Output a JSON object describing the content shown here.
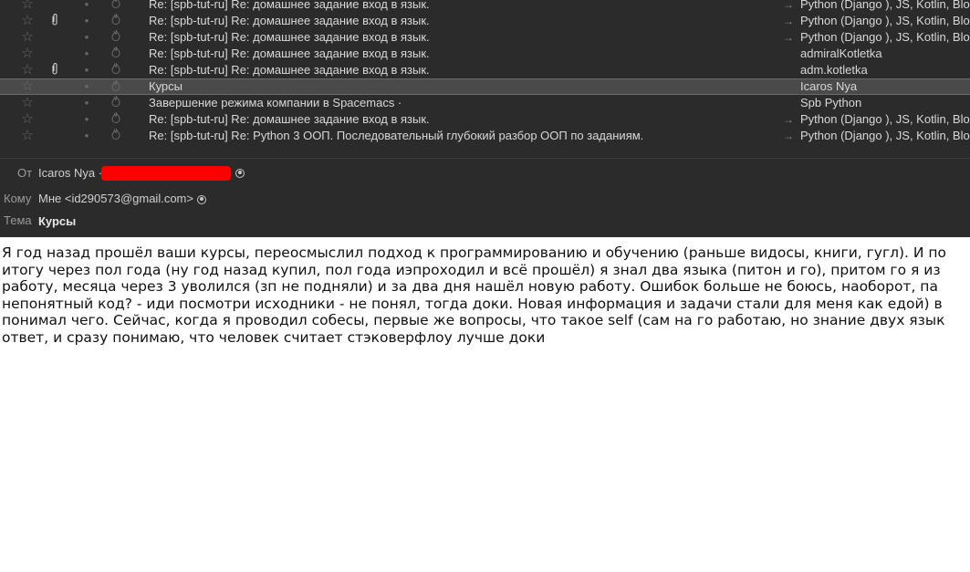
{
  "message_list": [
    {
      "subject": "Re: [spb-tut-ru] Re: домашнее задание вход в язык.",
      "sender": "Python (Django ), JS, Kotlin, Blo",
      "attachment": false,
      "arrow": true
    },
    {
      "subject": "Re: [spb-tut-ru] Re: домашнее задание вход в язык.",
      "sender": "Python (Django ), JS, Kotlin, Blo",
      "attachment": true,
      "arrow": true
    },
    {
      "subject": "Re: [spb-tut-ru] Re: домашнее задание вход в язык.",
      "sender": "Python (Django ), JS, Kotlin, Blo",
      "attachment": false,
      "arrow": true
    },
    {
      "subject": "Re: [spb-tut-ru] Re: домашнее задание вход в язык.",
      "sender": "admiralKotletka",
      "attachment": false,
      "arrow": false
    },
    {
      "subject": "Re: [spb-tut-ru] Re: домашнее задание вход в язык.",
      "sender": "adm.kotletka",
      "attachment": true,
      "arrow": false
    },
    {
      "subject": "Курсы",
      "sender": "Icaros Nya",
      "attachment": false,
      "arrow": false,
      "selected": true
    },
    {
      "subject": "Завершение режима компании в Spacemacs ·",
      "sender": "Spb Python",
      "attachment": false,
      "arrow": false
    },
    {
      "subject": "Re: [spb-tut-ru] Re: домашнее задание вход в язык.",
      "sender": "Python (Django ), JS, Kotlin, Blo",
      "attachment": false,
      "arrow": true
    },
    {
      "subject": "Re: [spb-tut-ru] Re: Python 3 ООП. Последовательный глубокий разбор ООП по заданиям.",
      "sender": "Python (Django ), JS, Kotlin, Blo",
      "attachment": false,
      "arrow": true
    }
  ],
  "icons": {
    "star": "star-icon",
    "attachment": "paperclip-icon",
    "read_status": "dot-icon",
    "junk": "flame-icon",
    "thread": "reply-arrow-icon",
    "contact": "person-icon"
  },
  "header": {
    "from_label": "От",
    "from_value": "Icaros Nya ·",
    "to_label": "Кому",
    "to_value": "Мне <id290573@gmail.com>",
    "subject_label": "Тема",
    "subject_value": "Курсы"
  },
  "body_lines": [
    "Я год назад прошёл ваши курсы, переосмыслил подход к программированию и обучению (раньше видосы, книги, гугл). И по",
    "итогу через пол года (ну год назад купил, пол года иэпроходил и всё прошёл) я знал два языка (питон и го), притом го я из",
    "работу, месяца через 3 уволился (зп не подняли) и за два дня нашёл новую работу. Ошибок больше не боюсь, наоборот, па",
    "непонятный код? - иди посмотри исходники - не понял, тогда доки. Новая информация и задачи стали для меня как едой) в",
    "понимал чего. Сейчас, когда я проводил собесы, первые же вопросы, что такое self (сам на го работаю, но знание двух язык",
    "ответ, и сразу понимаю, что человек считает стэковерфлоу лучше доки"
  ],
  "colors": {
    "list_bg": "#2b2b2b",
    "selected_bg": "#4a4a4a",
    "redaction": "#ff0000",
    "text_light": "#d8d8d8"
  }
}
